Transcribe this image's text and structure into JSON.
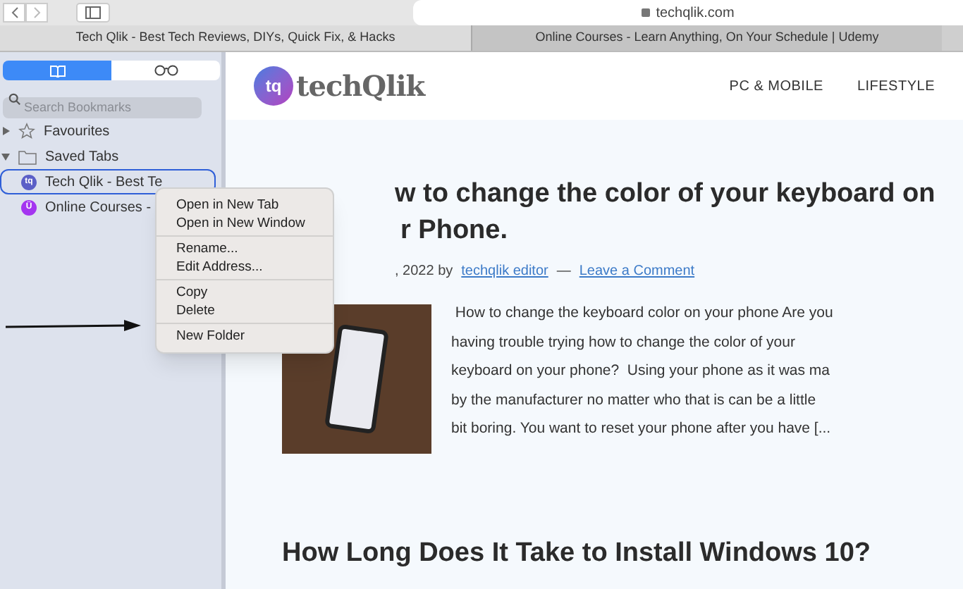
{
  "address_bar": {
    "url": "techqlik.com"
  },
  "tabs": [
    {
      "label": "Tech Qlik - Best Tech Reviews, DIYs, Quick Fix, & Hacks",
      "selected": true
    },
    {
      "label": "Online Courses - Learn Anything, On Your Schedule | Udemy",
      "selected": false
    }
  ],
  "sidebar": {
    "modes": [
      {
        "kind": "bookmarks",
        "selected": true
      },
      {
        "kind": "reading-list",
        "selected": false
      }
    ],
    "search": {
      "placeholder": "Search Bookmarks"
    },
    "items": [
      {
        "label": "Favourites",
        "kind": "star",
        "expanded": false
      },
      {
        "label": "Saved Tabs",
        "kind": "folder",
        "expanded": true,
        "children": [
          {
            "label": "Tech Qlik - Best Te",
            "kind": "site",
            "icon": "tq",
            "color": "#5b5fc7",
            "selected": true
          },
          {
            "label": "Online Courses -",
            "kind": "site",
            "icon": "Ü",
            "color": "#a435f0",
            "selected": false
          }
        ]
      }
    ]
  },
  "context_menu": {
    "groups": [
      [
        "Open in New Tab",
        "Open in New Window"
      ],
      [
        "Rename...",
        "Edit Address..."
      ],
      [
        "Copy",
        "Delete"
      ],
      [
        "New Folder"
      ]
    ]
  },
  "page": {
    "logo": {
      "badge": "tq",
      "text": "techQlik"
    },
    "nav": [
      "PC & MOBILE",
      "LIFESTYLE"
    ],
    "article": {
      "title_lines": [
        "w to change the color of your keyboard on",
        "r Phone."
      ],
      "meta": ", 2022 by",
      "author": "techqlik editor",
      "separator": "—",
      "comment_link": "Leave a Comment",
      "excerpt_lines": [
        " How to change the keyboard color on your phone Are you",
        "having trouble trying how to change the color of your",
        "keyboard on your phone?  Using your phone as it was ma",
        "by the manufacturer no matter who that is can be a little",
        "bit boring. You want to reset your phone after you have [..."
      ]
    },
    "next_title": "How Long Does It Take to Install Windows 10?"
  }
}
